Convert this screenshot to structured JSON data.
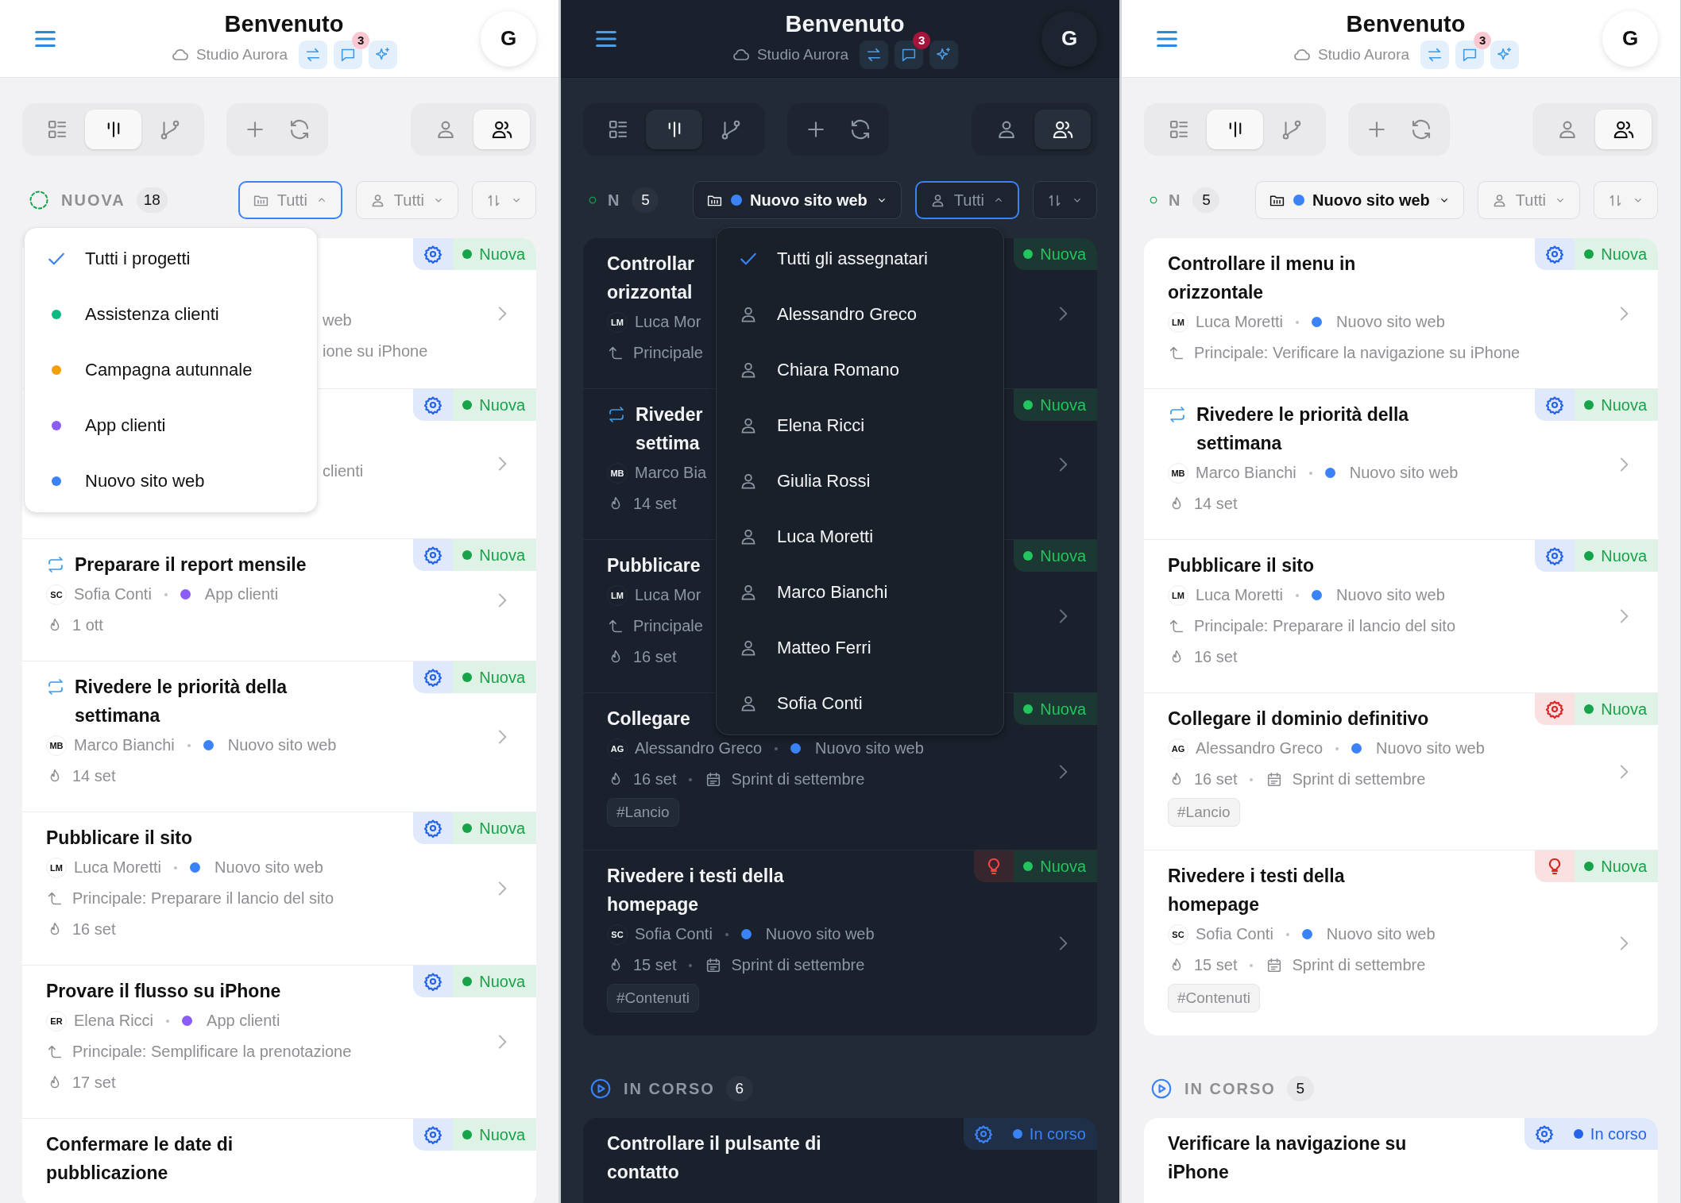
{
  "panels": [
    {
      "kind": "light",
      "header": {
        "title": "Benvenuto",
        "workspace": "Studio Aurora",
        "unread": "3",
        "avatar": "G"
      },
      "toolbar": {
        "views": [
          {
            "selected": false
          },
          {
            "selected": true
          },
          {
            "selected": false
          }
        ],
        "scopes": [
          {
            "selected": false
          },
          {
            "selected": true
          }
        ]
      },
      "column": {
        "label": "NUOVA",
        "count": "18",
        "compact": false
      },
      "filters": [
        {
          "kind": "project",
          "label": "Tutti",
          "open": true
        },
        {
          "kind": "assignee",
          "label": "Tutti",
          "open": false
        },
        {
          "kind": "sort",
          "open": false
        }
      ],
      "menu": {
        "kind": "project",
        "items": [
          {
            "label": "Tutti i progetti",
            "selected": true
          },
          {
            "label": "Assistenza clienti",
            "selected": false,
            "color": "#10b981"
          },
          {
            "label": "Campagna autunnale",
            "selected": false,
            "color": "#f59e0b"
          },
          {
            "label": "App clienti",
            "selected": false,
            "color": "#8b5cf6"
          },
          {
            "label": "Nuovo sito web",
            "selected": false,
            "color": "#3b82f6"
          }
        ]
      },
      "cards": [
        {
          "kind": "covered",
          "badge": {
            "kind": "settings",
            "color": "#2563eb",
            "status": {
              "text": "Nuova",
              "color": "#16a34a"
            }
          },
          "fragments": [
            "web",
            "ione su iPhone"
          ]
        },
        {
          "kind": "covered",
          "badge": {
            "kind": "settings",
            "color": "#2563eb",
            "status": {
              "text": "Nuova",
              "color": "#16a34a"
            }
          },
          "fragments": [
            "clienti"
          ]
        },
        {
          "kind": "task",
          "title": "Preparare il report mensile",
          "repeat": true,
          "initials": "SC",
          "assignee": "Sofia Conti",
          "project": {
            "name": "App clienti",
            "color": "#8b5cf6"
          },
          "date": "1 ott",
          "badge": {
            "kind": "settings",
            "color": "#2563eb",
            "status": {
              "text": "Nuova",
              "color": "#16a34a"
            }
          }
        },
        {
          "kind": "task",
          "title": "Rivedere le priorità della settimana",
          "repeat": true,
          "initials": "MB",
          "assignee": "Marco Bianchi",
          "project": {
            "name": "Nuovo sito web",
            "color": "#3b82f6"
          },
          "date": "14 set",
          "badge": {
            "kind": "settings",
            "color": "#2563eb",
            "status": {
              "text": "Nuova",
              "color": "#16a34a"
            }
          }
        },
        {
          "kind": "task",
          "title": "Pubblicare il sito",
          "repeat": false,
          "initials": "LM",
          "assignee": "Luca Moretti",
          "project": {
            "name": "Nuovo sito web",
            "color": "#3b82f6"
          },
          "parent": "Principale: Preparare il lancio del sito",
          "date": "16 set",
          "badge": {
            "kind": "settings",
            "color": "#2563eb",
            "status": {
              "text": "Nuova",
              "color": "#16a34a"
            }
          }
        },
        {
          "kind": "task",
          "title": "Provare il flusso su iPhone",
          "repeat": false,
          "initials": "ER",
          "assignee": "Elena Ricci",
          "project": {
            "name": "App clienti",
            "color": "#8b5cf6"
          },
          "parent": "Principale: Semplificare la prenotazione",
          "date": "17 set",
          "badge": {
            "kind": "settings",
            "color": "#2563eb",
            "status": {
              "text": "Nuova",
              "color": "#16a34a"
            }
          }
        },
        {
          "kind": "task",
          "title": "Confermare le date di pubblicazione",
          "repeat": false,
          "badge": {
            "kind": "settings",
            "color": "#2563eb",
            "status": {
              "text": "Nuova",
              "color": "#16a34a"
            }
          }
        }
      ]
    },
    {
      "kind": "dark",
      "header": {
        "title": "Benvenuto",
        "workspace": "Studio Aurora",
        "unread": "3",
        "avatar": "G"
      },
      "toolbar": {
        "views": [
          {
            "selected": false
          },
          {
            "selected": true
          },
          {
            "selected": false
          }
        ],
        "scopes": [
          {
            "selected": false
          },
          {
            "selected": true
          }
        ]
      },
      "column": {
        "label": "N",
        "count": "5",
        "compact": true
      },
      "filters": [
        {
          "kind": "project",
          "label": "Nuovo sito web",
          "color": "#3b82f6",
          "open": false
        },
        {
          "kind": "assignee",
          "label": "Tutti",
          "open": true
        },
        {
          "kind": "sort",
          "open": false
        }
      ],
      "menu": {
        "kind": "assignee",
        "items": [
          {
            "label": "Tutti gli assegnatari",
            "selected": true
          },
          {
            "label": "Alessandro Greco",
            "selected": false
          },
          {
            "label": "Chiara Romano",
            "selected": false
          },
          {
            "label": "Elena Ricci",
            "selected": false
          },
          {
            "label": "Giulia Rossi",
            "selected": false
          },
          {
            "label": "Luca Moretti",
            "selected": false
          },
          {
            "label": "Marco Bianchi",
            "selected": false
          },
          {
            "label": "Matteo Ferri",
            "selected": false
          },
          {
            "label": "Sofia Conti",
            "selected": false
          }
        ]
      },
      "cards": [
        {
          "kind": "task",
          "title": "Controllar\norizzontal",
          "repeat": false,
          "initials": "LM",
          "assignee": "Luca Mor",
          "parent": "Principale",
          "badge": {
            "status": {
              "text": "Nuova",
              "color": "#22c55e"
            }
          }
        },
        {
          "kind": "task",
          "title": "Riveder\nsettima",
          "repeat": true,
          "initials": "MB",
          "assignee": "Marco Bia",
          "date": "14 set",
          "badge": {
            "status": {
              "text": "Nuova",
              "color": "#22c55e"
            }
          }
        },
        {
          "kind": "task",
          "title": "Pubblicare",
          "repeat": false,
          "initials": "LM",
          "assignee": "Luca Mor",
          "parent": "Principale",
          "date": "16 set",
          "badge": {
            "status": {
              "text": "Nuova",
              "color": "#22c55e"
            }
          }
        },
        {
          "kind": "task",
          "title": "Collegare",
          "repeat": false,
          "initials": "AG",
          "assignee": "Alessandro Greco",
          "project": {
            "name": "Nuovo sito web",
            "color": "#3b82f6"
          },
          "date": "16 set",
          "sprint": "Sprint di settembre",
          "tag": "#Lancio",
          "badge": {
            "status": {
              "text": "Nuova",
              "color": "#22c55e"
            }
          }
        },
        {
          "kind": "task",
          "title": "Rivedere i testi della homepage",
          "repeat": false,
          "initials": "SC",
          "assignee": "Sofia Conti",
          "project": {
            "name": "Nuovo sito web",
            "color": "#3b82f6"
          },
          "date": "15 set",
          "sprint": "Sprint di settembre",
          "tag": "#Contenuti",
          "badge": {
            "kind": "idea",
            "color": "#ef4444",
            "status": {
              "text": "Nuova",
              "color": "#22c55e"
            }
          }
        }
      ],
      "next_section": {
        "label": "IN CORSO",
        "count": "6",
        "cards": [
          {
            "kind": "task",
            "title": "Controllare il pulsante di contatto",
            "repeat": false,
            "badge": {
              "kind": "settings",
              "color": "#3b82f6",
              "status": {
                "text": "In corso",
                "color": "#3b82f6"
              }
            }
          }
        ]
      }
    },
    {
      "kind": "light",
      "header": {
        "title": "Benvenuto",
        "workspace": "Studio Aurora",
        "unread": "3",
        "avatar": "G"
      },
      "toolbar": {
        "views": [
          {
            "selected": false
          },
          {
            "selected": true
          },
          {
            "selected": false
          }
        ],
        "scopes": [
          {
            "selected": false
          },
          {
            "selected": true
          }
        ]
      },
      "column": {
        "label": "N",
        "count": "5",
        "compact": true
      },
      "filters": [
        {
          "kind": "project",
          "label": "Nuovo sito web",
          "color": "#3b82f6",
          "open": false
        },
        {
          "kind": "assignee",
          "label": "Tutti",
          "open": false
        },
        {
          "kind": "sort",
          "open": false
        }
      ],
      "cards": [
        {
          "kind": "task",
          "title": "Controllare il menu in orizzontale",
          "repeat": false,
          "initials": "LM",
          "assignee": "Luca Moretti",
          "project": {
            "name": "Nuovo sito web",
            "color": "#3b82f6"
          },
          "parent": "Principale: Verificare la navigazione su iPhone",
          "badge": {
            "kind": "settings",
            "color": "#2563eb",
            "status": {
              "text": "Nuova",
              "color": "#16a34a"
            }
          }
        },
        {
          "kind": "task",
          "title": "Rivedere le priorità della settimana",
          "repeat": true,
          "initials": "MB",
          "assignee": "Marco Bianchi",
          "project": {
            "name": "Nuovo sito web",
            "color": "#3b82f6"
          },
          "date": "14 set",
          "badge": {
            "kind": "settings",
            "color": "#2563eb",
            "status": {
              "text": "Nuova",
              "color": "#16a34a"
            }
          }
        },
        {
          "kind": "task",
          "title": "Pubblicare il sito",
          "repeat": false,
          "initials": "LM",
          "assignee": "Luca Moretti",
          "project": {
            "name": "Nuovo sito web",
            "color": "#3b82f6"
          },
          "parent": "Principale: Preparare il lancio del sito",
          "date": "16 set",
          "badge": {
            "kind": "settings",
            "color": "#2563eb",
            "status": {
              "text": "Nuova",
              "color": "#16a34a"
            }
          }
        },
        {
          "kind": "task",
          "title": "Collegare il dominio definitivo",
          "repeat": false,
          "initials": "AG",
          "assignee": "Alessandro Greco",
          "project": {
            "name": "Nuovo sito web",
            "color": "#3b82f6"
          },
          "date": "16 set",
          "sprint": "Sprint di settembre",
          "tag": "#Lancio",
          "badge": {
            "kind": "settings",
            "color": "#dc2626",
            "status": {
              "text": "Nuova",
              "color": "#16a34a"
            }
          }
        },
        {
          "kind": "task",
          "title": "Rivedere i testi della homepage",
          "repeat": false,
          "initials": "SC",
          "assignee": "Sofia Conti",
          "project": {
            "name": "Nuovo sito web",
            "color": "#3b82f6"
          },
          "date": "15 set",
          "sprint": "Sprint di settembre",
          "tag": "#Contenuti",
          "badge": {
            "kind": "idea",
            "color": "#dc2626",
            "status": {
              "text": "Nuova",
              "color": "#16a34a"
            }
          }
        }
      ],
      "next_section": {
        "label": "IN CORSO",
        "count": "5",
        "cards": [
          {
            "kind": "task",
            "title": "Verificare la navigazione su iPhone",
            "repeat": false,
            "badge": {
              "kind": "settings",
              "color": "#2563eb",
              "status": {
                "text": "In corso",
                "color": "#2563eb"
              }
            }
          }
        ]
      }
    }
  ]
}
